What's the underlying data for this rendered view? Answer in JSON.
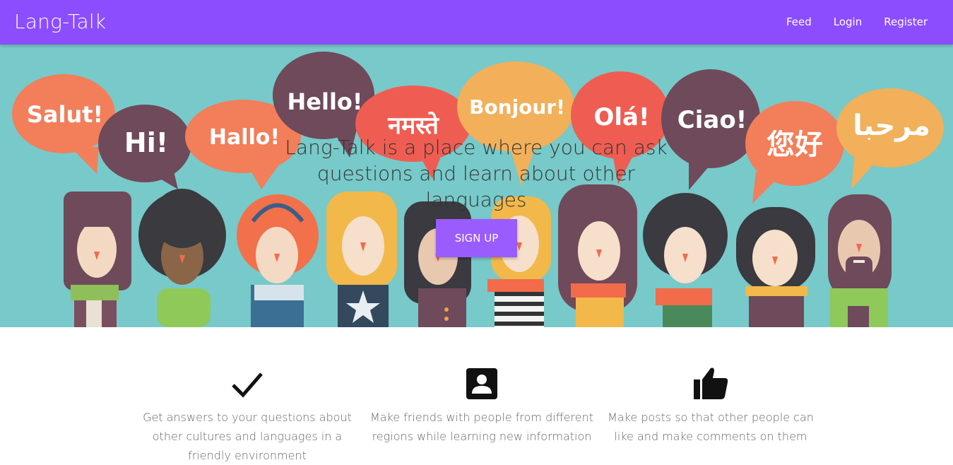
{
  "navbar": {
    "brand": "Lang-Talk",
    "links": [
      "Feed",
      "Login",
      "Register"
    ],
    "color": "#8c4dff"
  },
  "hero": {
    "background": "#78c9c9",
    "headline": "Lang-Talk is a place where you can ask questions and learn about other languages",
    "signup_label": "SIGN UP",
    "bubbles": [
      "Salut!",
      "Hi!",
      "Hallo!",
      "Hello!",
      "नमस्ते",
      "Bonjour!",
      "Olá!",
      "Ciao!",
      "您好",
      "مرحبا"
    ]
  },
  "features": [
    {
      "icon": "check-icon",
      "text": "Get answers to your questions about other cultures and languages in a friendly environment"
    },
    {
      "icon": "contact-card-icon",
      "text": "Make friends with people from different regions while learning new information"
    },
    {
      "icon": "thumbs-up-icon",
      "text": "Make posts so that other people can like and make comments on them"
    }
  ]
}
